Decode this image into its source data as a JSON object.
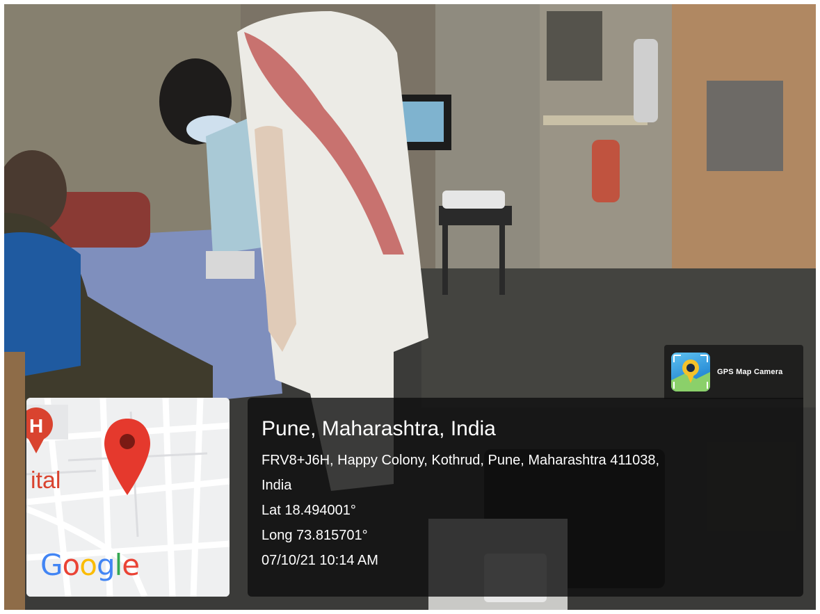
{
  "app": {
    "badge_label": "GPS Map Camera",
    "badge_icon": "gps-camera-logo-icon"
  },
  "location": {
    "title": "Pune, Maharashtra, India",
    "address_line1": "FRV8+J6H, Happy Colony, Kothrud, Pune, Maharashtra 411038,",
    "address_line2": "India",
    "latitude": "Lat 18.494001°",
    "longitude": "Long 73.815701°",
    "datetime": "07/10/21 10:14 AM"
  },
  "map": {
    "poi_label": "ital",
    "poi_icon": "hospital-marker-icon",
    "pin_icon": "location-pin-icon",
    "brand": [
      "G",
      "o",
      "o",
      "g",
      "l",
      "e"
    ],
    "pin_color": "#e5392d",
    "poi_color": "#d9432f"
  },
  "colors": {
    "overlay": "#0f0f0f",
    "text": "#ffffff"
  }
}
